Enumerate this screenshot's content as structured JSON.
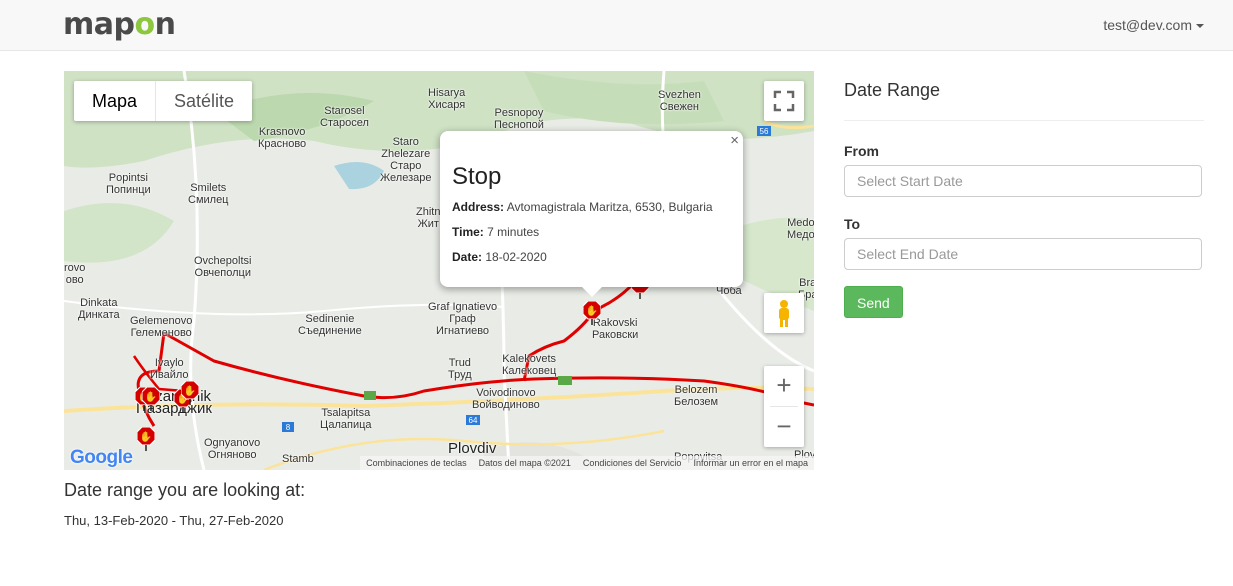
{
  "header": {
    "logo_parts": [
      "map",
      "o",
      "n"
    ],
    "user_email": "test@dev.com"
  },
  "map": {
    "map_types": [
      "Mapa",
      "Satélite"
    ],
    "active_map_type": "Mapa",
    "places": [
      {
        "id": "hisarya",
        "lines": [
          "Hisarya",
          "Хисаря"
        ]
      },
      {
        "id": "pesnopoy",
        "lines": [
          "Pesnopoy",
          "Песнопой"
        ]
      },
      {
        "id": "svezhen",
        "lines": [
          "Svezhen",
          "Свежен"
        ]
      },
      {
        "id": "starosel",
        "lines": [
          "Starosel",
          "Старосел"
        ]
      },
      {
        "id": "krasnovo",
        "lines": [
          "Krasnovo",
          "Красново"
        ]
      },
      {
        "id": "staro-zhelezare",
        "lines": [
          "Staro",
          "Zhelezare",
          "Старо",
          "Железаре"
        ]
      },
      {
        "id": "popintsi",
        "lines": [
          "Popintsi",
          "Попинци"
        ]
      },
      {
        "id": "smilets",
        "lines": [
          "Smilets",
          "Смилец"
        ]
      },
      {
        "id": "zhitnitsa",
        "lines": [
          "Zhitn",
          "Жит"
        ]
      },
      {
        "id": "medovo",
        "lines": [
          "Medo",
          "Медо"
        ]
      },
      {
        "id": "ovchepoltsi",
        "lines": [
          "Ovchepoltsi",
          "Овчеполци"
        ]
      },
      {
        "id": "rovo",
        "lines": [
          "rovo",
          "ово"
        ]
      },
      {
        "id": "dinkata",
        "lines": [
          "Dinkata",
          "Динката"
        ]
      },
      {
        "id": "gelemenovo",
        "lines": [
          "Gelemenovo",
          "Гелеменово"
        ]
      },
      {
        "id": "sedinenie",
        "lines": [
          "Sedinenie",
          "Съединение"
        ]
      },
      {
        "id": "graf-ignatievo",
        "lines": [
          "Graf Ignatievo",
          "Граф",
          "Игнатиево"
        ]
      },
      {
        "id": "rakovski",
        "lines": [
          "Rakovski",
          "Раковски"
        ]
      },
      {
        "id": "choba",
        "lines": [
          "Чоба"
        ]
      },
      {
        "id": "bra",
        "lines": [
          "Bra",
          "Бра"
        ]
      },
      {
        "id": "ivaylo",
        "lines": [
          "Ivaylo",
          "Ивайло"
        ]
      },
      {
        "id": "trud",
        "lines": [
          "Trud",
          "Труд"
        ]
      },
      {
        "id": "kalekovets",
        "lines": [
          "Kalekovets",
          "Калековец"
        ]
      },
      {
        "id": "voivodinovo",
        "lines": [
          "Voivodinovo",
          "Войводиново"
        ]
      },
      {
        "id": "belozem",
        "lines": [
          "Belozem",
          "Белозем"
        ]
      },
      {
        "id": "pazardzhik",
        "lines": [
          "Pazardzhik",
          "Пазарджик"
        ]
      },
      {
        "id": "tsalapitsa",
        "lines": [
          "Tsalapitsa",
          "Цалапица"
        ]
      },
      {
        "id": "ognyanovo",
        "lines": [
          "Ognyanovo",
          "Огняново"
        ]
      },
      {
        "id": "plovdiv",
        "lines": [
          "Plovdiv"
        ]
      },
      {
        "id": "popovitsa",
        "lines": [
          "Popovitsa"
        ]
      },
      {
        "id": "plov",
        "lines": [
          "Plov"
        ]
      },
      {
        "id": "stam",
        "lines": [
          "Stamb"
        ]
      }
    ],
    "road_numbers": [
      "56",
      "8",
      "64",
      "8"
    ],
    "attribution": [
      "Combinaciones de teclas",
      "Datos del mapa ©2021",
      "Condiciones del Servicio",
      "Informar un error en el mapa"
    ],
    "google_logo": "Google",
    "route_color": "#e00000",
    "infowindow": {
      "title": "Stop",
      "rows": [
        {
          "label": "Address:",
          "value": "Avtomagistrala Maritza, 6530, Bulgaria"
        },
        {
          "label": "Time:",
          "value": "7 minutes"
        },
        {
          "label": "Date:",
          "value": "18-02-2020"
        }
      ],
      "close": "×"
    },
    "zoom_in": "+",
    "zoom_out": "−"
  },
  "sidebar": {
    "title": "Date Range",
    "from_label": "From",
    "from_placeholder": "Select Start Date",
    "to_label": "To",
    "to_placeholder": "Select End Date",
    "send_label": "Send",
    "send_color": "#5cb85c"
  },
  "range": {
    "heading": "Date range you are looking at:",
    "value": "Thu, 13-Feb-2020 - Thu, 27-Feb-2020"
  }
}
